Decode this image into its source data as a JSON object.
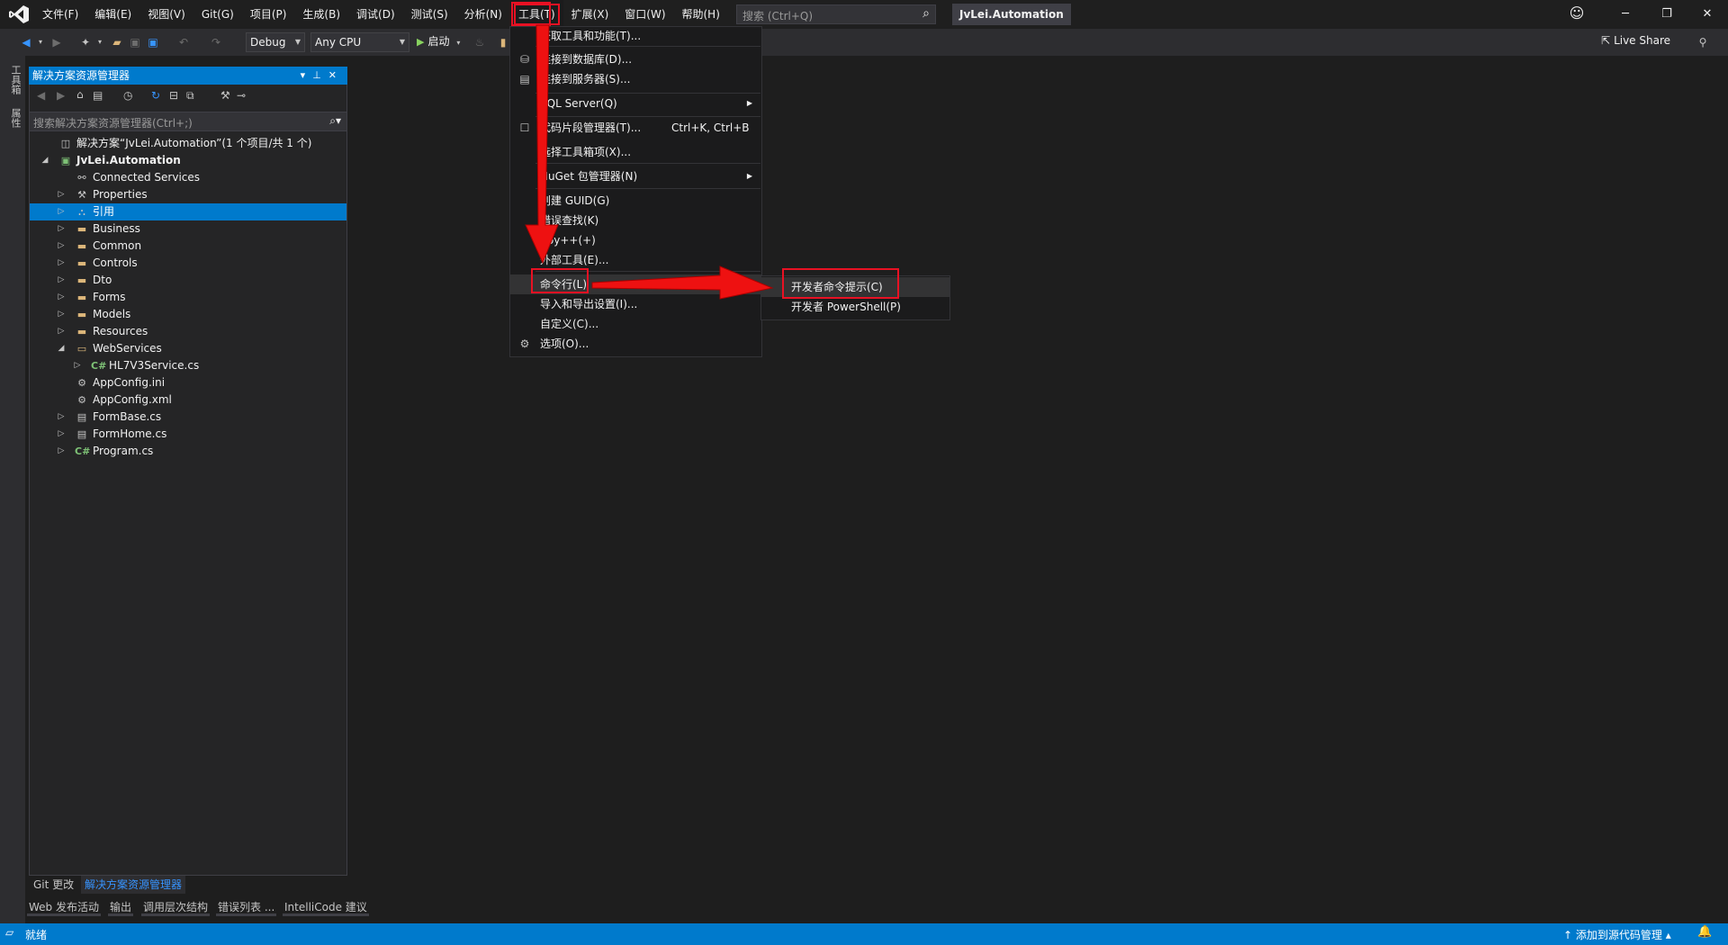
{
  "app": {
    "solution_name": "JvLei.Automation"
  },
  "menubar": {
    "items": [
      "文件(F)",
      "编辑(E)",
      "视图(V)",
      "Git(G)",
      "项目(P)",
      "生成(B)",
      "调试(D)",
      "测试(S)",
      "分析(N)",
      "工具(T)",
      "扩展(X)",
      "窗口(W)",
      "帮助(H)"
    ],
    "open_item": "工具(T)",
    "search_placeholder": "搜索 (Ctrl+Q)"
  },
  "toolbar": {
    "config": "Debug",
    "platform": "Any CPU",
    "start_label": "启动",
    "live_share": "Live Share"
  },
  "left_strip": {
    "tabs": [
      "工具箱",
      "属性"
    ]
  },
  "solution_explorer": {
    "title": "解决方案资源管理器",
    "search_placeholder": "搜索解决方案资源管理器(Ctrl+;)",
    "tree": [
      {
        "label": "解决方案“JvLei.Automation”(1 个项目/共 1 个)",
        "icon": "solution-icon",
        "expander": "",
        "depth": 0
      },
      {
        "label": "JvLei.Automation",
        "icon": "csproj-icon",
        "expander": "expanded",
        "depth": 1,
        "bold": true
      },
      {
        "label": "Connected Services",
        "icon": "connected-services-icon",
        "expander": "",
        "depth": 2
      },
      {
        "label": "Properties",
        "icon": "wrench-icon",
        "expander": "collapsed",
        "depth": 2
      },
      {
        "label": "引用",
        "icon": "references-icon",
        "expander": "collapsed",
        "depth": 2,
        "selected": true
      },
      {
        "label": "Business",
        "icon": "folder-icon",
        "expander": "collapsed",
        "depth": 2
      },
      {
        "label": "Common",
        "icon": "folder-icon",
        "expander": "collapsed",
        "depth": 2
      },
      {
        "label": "Controls",
        "icon": "folder-icon",
        "expander": "collapsed",
        "depth": 2
      },
      {
        "label": "Dto",
        "icon": "folder-icon",
        "expander": "collapsed",
        "depth": 2
      },
      {
        "label": "Forms",
        "icon": "folder-icon",
        "expander": "collapsed",
        "depth": 2
      },
      {
        "label": "Models",
        "icon": "folder-icon",
        "expander": "collapsed",
        "depth": 2
      },
      {
        "label": "Resources",
        "icon": "folder-icon",
        "expander": "collapsed",
        "depth": 2
      },
      {
        "label": "WebServices",
        "icon": "folder-open-icon",
        "expander": "expanded",
        "depth": 2
      },
      {
        "label": "HL7V3Service.cs",
        "icon": "csharp-file-icon",
        "expander": "collapsed",
        "depth": 3
      },
      {
        "label": "AppConfig.ini",
        "icon": "config-file-icon",
        "expander": "",
        "depth": 2
      },
      {
        "label": "AppConfig.xml",
        "icon": "config-file-icon",
        "expander": "",
        "depth": 2
      },
      {
        "label": "FormBase.cs",
        "icon": "form-file-icon",
        "expander": "collapsed",
        "depth": 2
      },
      {
        "label": "FormHome.cs",
        "icon": "form-file-icon",
        "expander": "collapsed",
        "depth": 2
      },
      {
        "label": "Program.cs",
        "icon": "csharp-file-icon",
        "expander": "collapsed",
        "depth": 2
      }
    ],
    "bottom_tabs": [
      "Git 更改",
      "解决方案资源管理器"
    ]
  },
  "output_tabs": [
    "Web 发布活动",
    "输出",
    "调用层次结构",
    "错误列表 ...",
    "IntelliCode 建议"
  ],
  "tools_menu": {
    "items": [
      {
        "label": "获取工具和功能(T)...",
        "shortcut": "",
        "submenu": false
      },
      {
        "label": "连接到数据库(D)...",
        "shortcut": "",
        "submenu": false
      },
      {
        "label": "连接到服务器(S)...",
        "shortcut": "",
        "submenu": false
      },
      {
        "label": "SQL Server(Q)",
        "shortcut": "",
        "submenu": true
      },
      {
        "label": "代码片段管理器(T)...",
        "shortcut": "Ctrl+K, Ctrl+B",
        "submenu": false
      },
      {
        "label": "选择工具箱项(X)...",
        "shortcut": "",
        "submenu": false
      },
      {
        "label": "NuGet 包管理器(N)",
        "shortcut": "",
        "submenu": true
      },
      {
        "label": "创建 GUID(G)",
        "shortcut": "",
        "submenu": false
      },
      {
        "label": "错误查找(K)",
        "shortcut": "",
        "submenu": false
      },
      {
        "label": "Spy++(+)",
        "shortcut": "",
        "submenu": false
      },
      {
        "label": "外部工具(E)...",
        "shortcut": "",
        "submenu": false
      },
      {
        "label": "命令行(L)",
        "shortcut": "",
        "submenu": true
      },
      {
        "label": "导入和导出设置(I)...",
        "shortcut": "",
        "submenu": false
      },
      {
        "label": "自定义(C)...",
        "shortcut": "",
        "submenu": false
      },
      {
        "label": "选项(O)...",
        "shortcut": "",
        "submenu": false
      }
    ]
  },
  "command_line_submenu": {
    "items": [
      "开发者命令提示(C)",
      "开发者 PowerShell(P)"
    ]
  },
  "statusbar": {
    "status": "就绪",
    "source_control": "添加到源代码管理"
  },
  "colors": {
    "accent": "#007acc",
    "annotation": "#e81123",
    "background": "#1e1e1e"
  }
}
